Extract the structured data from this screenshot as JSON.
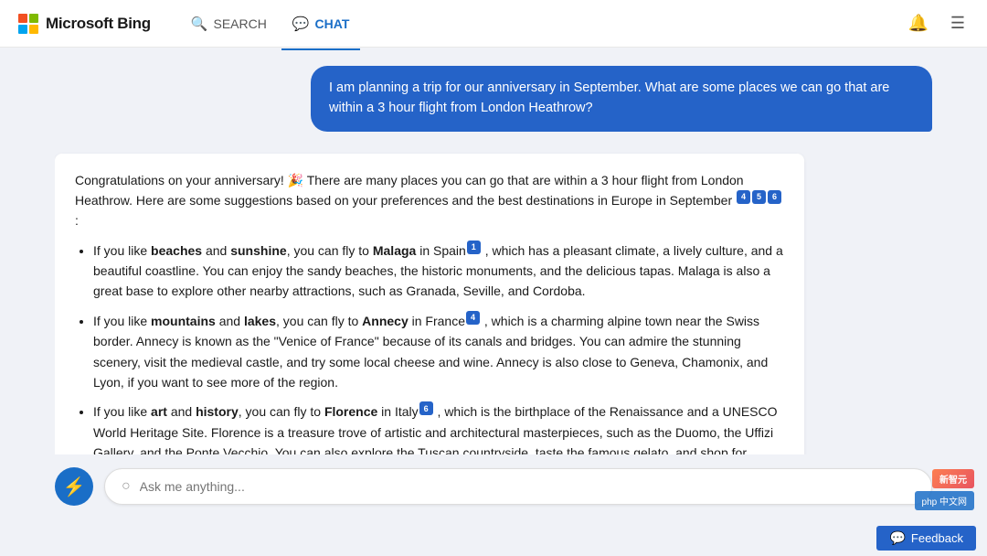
{
  "header": {
    "logo_text": "Microsoft Bing",
    "nav_search_label": "SEARCH",
    "nav_chat_label": "CHAT"
  },
  "user_message": {
    "text": "I am planning a trip for our anniversary in September. What are some places we can go that are within a 3 hour flight from London Heathrow?"
  },
  "ai_response": {
    "intro": "Congratulations on your anniversary! 🎉 There are many places you can go that are within a 3 hour flight from London Heathrow. Here are some suggestions based on your preferences and the best destinations in Europe in September",
    "citations_intro": [
      "4",
      "5",
      "6"
    ],
    "items": [
      {
        "text_parts": [
          {
            "text": "If you like ",
            "bold": false
          },
          {
            "text": "beaches",
            "bold": true
          },
          {
            "text": " and ",
            "bold": false
          },
          {
            "text": "sunshine",
            "bold": true
          },
          {
            "text": ", you can fly to ",
            "bold": false
          },
          {
            "text": "Malaga",
            "bold": true
          },
          {
            "text": " in Spain",
            "bold": false
          }
        ],
        "citation": "1",
        "rest": ", which has a pleasant climate, a lively culture, and a beautiful coastline. You can enjoy the sandy beaches, the historic monuments, and the delicious tapas. Malaga is also a great base to explore other nearby attractions, such as Granada, Seville, and Cordoba."
      },
      {
        "text_parts": [
          {
            "text": "If you like ",
            "bold": false
          },
          {
            "text": "mountains",
            "bold": true
          },
          {
            "text": " and ",
            "bold": false
          },
          {
            "text": "lakes",
            "bold": true
          },
          {
            "text": ", you can fly to ",
            "bold": false
          },
          {
            "text": "Annecy",
            "bold": true
          },
          {
            "text": " in France",
            "bold": false
          }
        ],
        "citation": "4",
        "rest": ", which is a charming alpine town near the Swiss border. Annecy is known as the \"Venice of France\" because of its canals and bridges. You can admire the stunning scenery, visit the medieval castle, and try some local cheese and wine. Annecy is also close to Geneva, Chamonix, and Lyon, if you want to see more of the region."
      },
      {
        "text_parts": [
          {
            "text": "If you like ",
            "bold": false
          },
          {
            "text": "art",
            "bold": true
          },
          {
            "text": " and ",
            "bold": false
          },
          {
            "text": "history",
            "bold": true
          },
          {
            "text": ", you can fly to ",
            "bold": false
          },
          {
            "text": "Florence",
            "bold": true
          },
          {
            "text": " in Italy",
            "bold": false
          }
        ],
        "citation": "6",
        "rest": ", which is the birthplace of the Renaissance and a UNESCO World Heritage Site. Florence is a treasure trove of artistic and architectural masterpieces, such as the Duomo, the Uffizi Gallery, and the Ponte Vecchio. You can also explore the Tuscan countryside, taste the famous gelato, and shop for leather goods."
      }
    ]
  },
  "input": {
    "placeholder": "Ask me anything..."
  },
  "footer": {
    "feedback_label": "Feedback"
  },
  "watermark": {
    "badge1": "新智元",
    "badge2": "php 中文网"
  }
}
